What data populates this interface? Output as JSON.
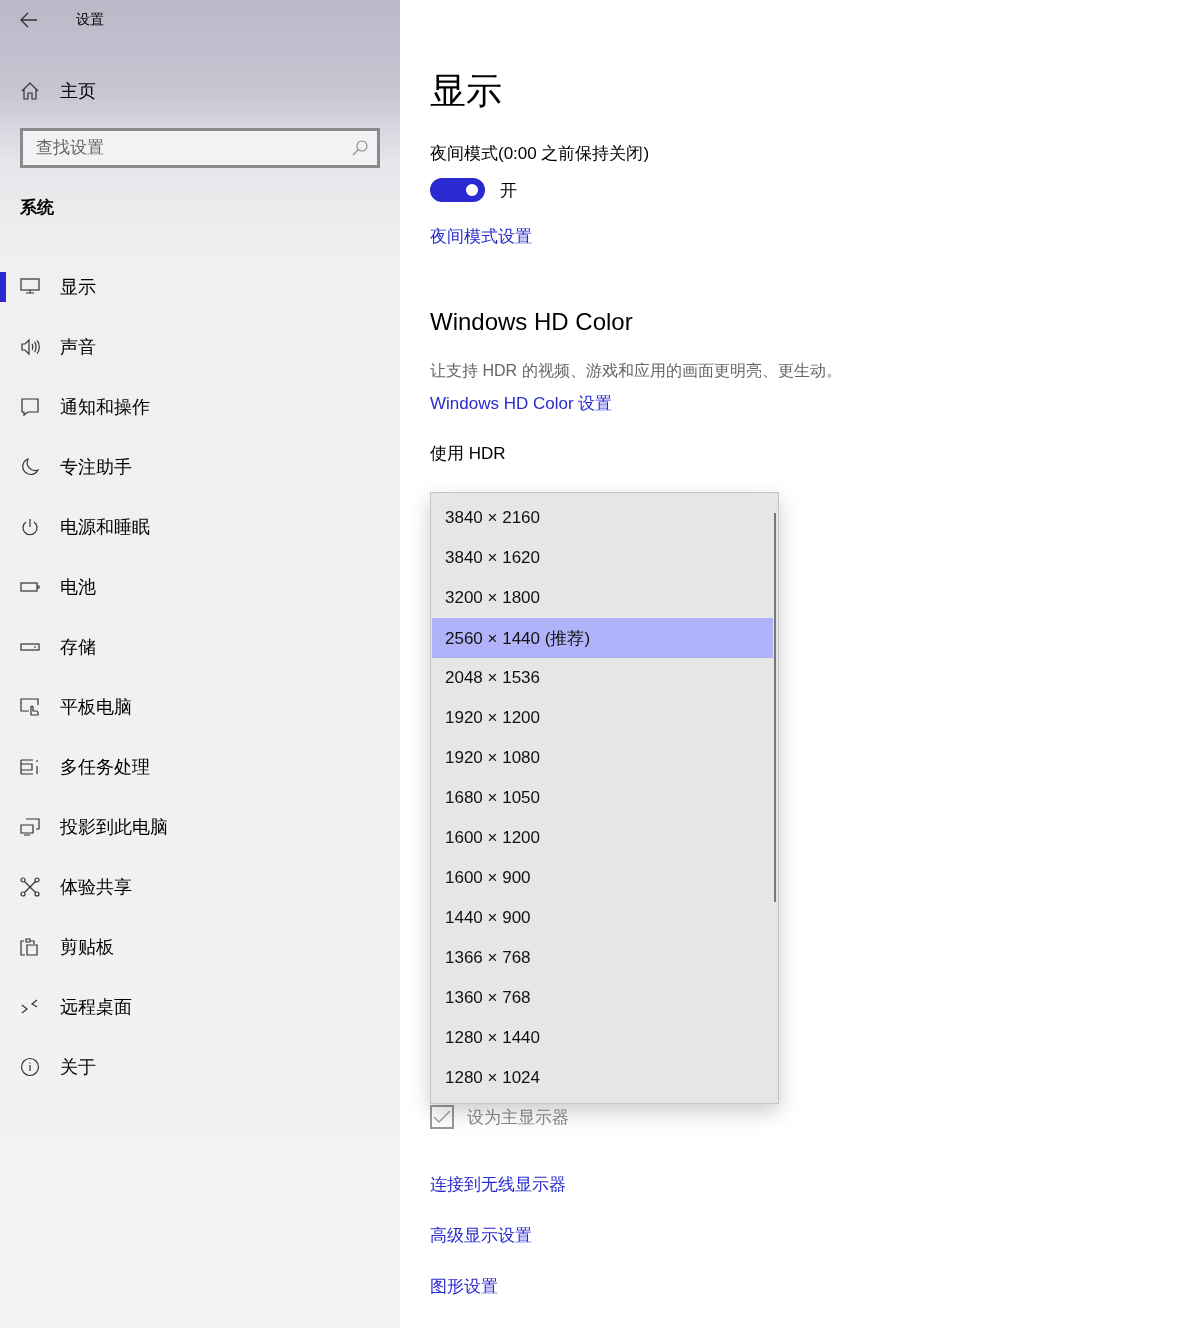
{
  "window": {
    "title": "设置"
  },
  "sidebar": {
    "home": "主页",
    "search": {
      "placeholder": "查找设置"
    },
    "section": "系统",
    "items": [
      {
        "label": "显示",
        "selected": true
      },
      {
        "label": "声音",
        "selected": false
      },
      {
        "label": "通知和操作",
        "selected": false
      },
      {
        "label": "专注助手",
        "selected": false
      },
      {
        "label": "电源和睡眠",
        "selected": false
      },
      {
        "label": "电池",
        "selected": false
      },
      {
        "label": "存储",
        "selected": false
      },
      {
        "label": "平板电脑",
        "selected": false
      },
      {
        "label": "多任务处理",
        "selected": false
      },
      {
        "label": "投影到此电脑",
        "selected": false
      },
      {
        "label": "体验共享",
        "selected": false
      },
      {
        "label": "剪贴板",
        "selected": false
      },
      {
        "label": "远程桌面",
        "selected": false
      },
      {
        "label": "关于",
        "selected": false
      }
    ]
  },
  "main": {
    "title": "显示",
    "night_light": {
      "label": "夜间模式(0:00 之前保持关闭)",
      "on": true,
      "state_text": "开",
      "link": "夜间模式设置"
    },
    "hd_color": {
      "heading": "Windows HD Color",
      "description": "让支持 HDR 的视频、游戏和应用的画面更明亮、更生动。",
      "link": "Windows HD Color 设置",
      "hdr_label": "使用 HDR"
    },
    "primary_display": {
      "label": "设为主显示器",
      "checked": true,
      "disabled": true
    },
    "links": [
      "连接到无线显示器",
      "高级显示设置",
      "图形设置"
    ]
  },
  "resolution_dropdown": {
    "options": [
      {
        "label": "3840 × 2160",
        "selected": false
      },
      {
        "label": "3840 × 1620",
        "selected": false
      },
      {
        "label": "3200 × 1800",
        "selected": false
      },
      {
        "label": "2560 × 1440 (推荐)",
        "selected": true
      },
      {
        "label": "2048 × 1536",
        "selected": false
      },
      {
        "label": "1920 × 1200",
        "selected": false
      },
      {
        "label": "1920 × 1080",
        "selected": false
      },
      {
        "label": "1680 × 1050",
        "selected": false
      },
      {
        "label": "1600 × 1200",
        "selected": false
      },
      {
        "label": "1600 × 900",
        "selected": false
      },
      {
        "label": "1440 × 900",
        "selected": false
      },
      {
        "label": "1366 × 768",
        "selected": false
      },
      {
        "label": "1360 × 768",
        "selected": false
      },
      {
        "label": "1280 × 1440",
        "selected": false
      },
      {
        "label": "1280 × 1024",
        "selected": false
      }
    ]
  }
}
